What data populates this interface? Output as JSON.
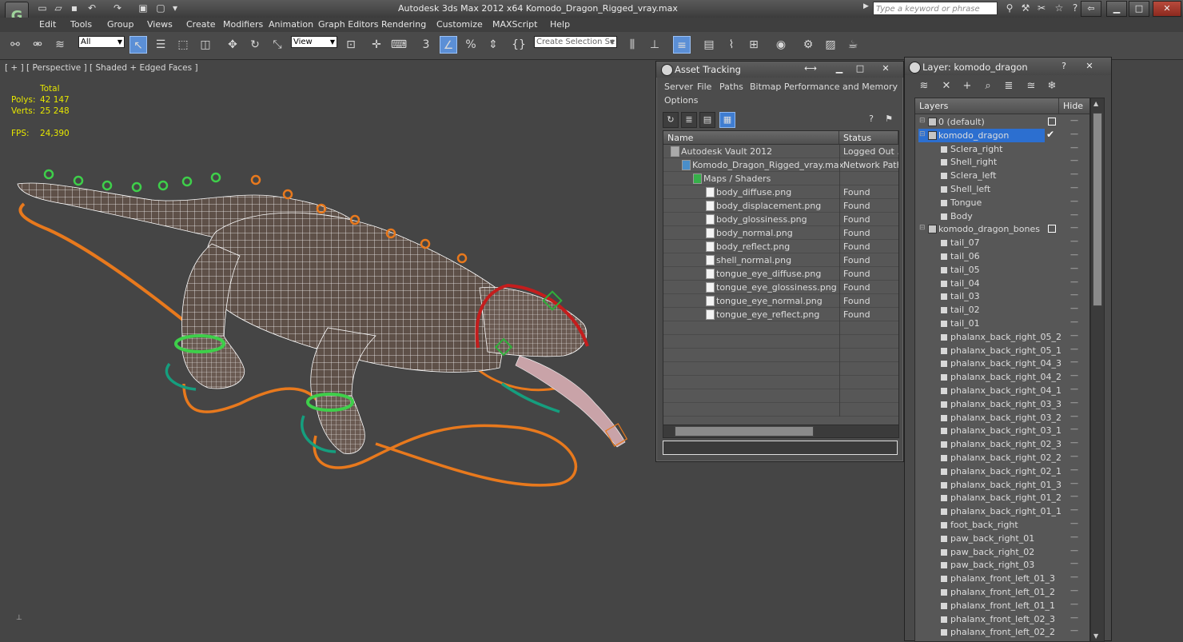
{
  "app": {
    "title": "Autodesk 3ds Max  2012 x64     Komodo_Dragon_Rigged_vray.max",
    "search_placeholder": "Type a keyword or phrase"
  },
  "menu": [
    "Edit",
    "Tools",
    "Group",
    "Views",
    "Create",
    "Modifiers",
    "Animation",
    "Graph Editors",
    "Rendering",
    "Customize",
    "MAXScript",
    "Help"
  ],
  "toolbar": {
    "filter_value": "All",
    "coord_value": "View",
    "selection_set_placeholder": "Create Selection Se"
  },
  "viewport": {
    "label": "[ + ] [ Perspective ] [ Shaded + Edged Faces ]",
    "stats": {
      "total_label": "Total",
      "polys_label": "Polys:",
      "polys_value": "42 147",
      "verts_label": "Verts:",
      "verts_value": "25 248",
      "fps_label": "FPS:",
      "fps_value": "24,390"
    }
  },
  "asset_tracking": {
    "title": "Asset Tracking",
    "menu": [
      "Server",
      "File",
      "Paths",
      "Bitmap Performance and Memory",
      "Options"
    ],
    "columns": [
      "Name",
      "Status"
    ],
    "rows": [
      {
        "name": "Autodesk Vault 2012",
        "status": "Logged Out ..."
      },
      {
        "name": "Komodo_Dragon_Rigged_vray.max",
        "status": "Network Path"
      },
      {
        "name": "Maps / Shaders",
        "status": ""
      },
      {
        "name": "body_diffuse.png",
        "status": "Found"
      },
      {
        "name": "body_displacement.png",
        "status": "Found"
      },
      {
        "name": "body_glossiness.png",
        "status": "Found"
      },
      {
        "name": "body_normal.png",
        "status": "Found"
      },
      {
        "name": "body_reflect.png",
        "status": "Found"
      },
      {
        "name": "shell_normal.png",
        "status": "Found"
      },
      {
        "name": "tongue_eye_diffuse.png",
        "status": "Found"
      },
      {
        "name": "tongue_eye_glossiness.png",
        "status": "Found"
      },
      {
        "name": "tongue_eye_normal.png",
        "status": "Found"
      },
      {
        "name": "tongue_eye_reflect.png",
        "status": "Found"
      }
    ]
  },
  "layer_panel": {
    "title": "Layer: komodo_dragon",
    "columns": [
      "Layers",
      "Hide"
    ],
    "rows": [
      {
        "name": "0 (default)",
        "level": 0,
        "type": "layer"
      },
      {
        "name": "komodo_dragon",
        "level": 0,
        "type": "layer",
        "selected": true
      },
      {
        "name": "Sclera_right",
        "level": 1,
        "type": "object"
      },
      {
        "name": "Shell_right",
        "level": 1,
        "type": "object"
      },
      {
        "name": "Sclera_left",
        "level": 1,
        "type": "object"
      },
      {
        "name": "Shell_left",
        "level": 1,
        "type": "object"
      },
      {
        "name": "Tongue",
        "level": 1,
        "type": "object"
      },
      {
        "name": "Body",
        "level": 1,
        "type": "object"
      },
      {
        "name": "komodo_dragon_bones",
        "level": 0,
        "type": "layer"
      },
      {
        "name": "tail_07",
        "level": 1,
        "type": "object"
      },
      {
        "name": "tail_06",
        "level": 1,
        "type": "object"
      },
      {
        "name": "tail_05",
        "level": 1,
        "type": "object"
      },
      {
        "name": "tail_04",
        "level": 1,
        "type": "object"
      },
      {
        "name": "tail_03",
        "level": 1,
        "type": "object"
      },
      {
        "name": "tail_02",
        "level": 1,
        "type": "object"
      },
      {
        "name": "tail_01",
        "level": 1,
        "type": "object"
      },
      {
        "name": "phalanx_back_right_05_2",
        "level": 1,
        "type": "object"
      },
      {
        "name": "phalanx_back_right_05_1",
        "level": 1,
        "type": "object"
      },
      {
        "name": "phalanx_back_right_04_3",
        "level": 1,
        "type": "object"
      },
      {
        "name": "phalanx_back_right_04_2",
        "level": 1,
        "type": "object"
      },
      {
        "name": "phalanx_back_right_04_1",
        "level": 1,
        "type": "object"
      },
      {
        "name": "phalanx_back_right_03_3",
        "level": 1,
        "type": "object"
      },
      {
        "name": "phalanx_back_right_03_2",
        "level": 1,
        "type": "object"
      },
      {
        "name": "phalanx_back_right_03_1",
        "level": 1,
        "type": "object"
      },
      {
        "name": "phalanx_back_right_02_3",
        "level": 1,
        "type": "object"
      },
      {
        "name": "phalanx_back_right_02_2",
        "level": 1,
        "type": "object"
      },
      {
        "name": "phalanx_back_right_02_1",
        "level": 1,
        "type": "object"
      },
      {
        "name": "phalanx_back_right_01_3",
        "level": 1,
        "type": "object"
      },
      {
        "name": "phalanx_back_right_01_2",
        "level": 1,
        "type": "object"
      },
      {
        "name": "phalanx_back_right_01_1",
        "level": 1,
        "type": "object"
      },
      {
        "name": "foot_back_right",
        "level": 1,
        "type": "object"
      },
      {
        "name": "paw_back_right_01",
        "level": 1,
        "type": "object"
      },
      {
        "name": "paw_back_right_02",
        "level": 1,
        "type": "object"
      },
      {
        "name": "paw_back_right_03",
        "level": 1,
        "type": "object"
      },
      {
        "name": "phalanx_front_left_01_3",
        "level": 1,
        "type": "object"
      },
      {
        "name": "phalanx_front_left_01_2",
        "level": 1,
        "type": "object"
      },
      {
        "name": "phalanx_front_left_01_1",
        "level": 1,
        "type": "object"
      },
      {
        "name": "phalanx_front_left_02_3",
        "level": 1,
        "type": "object"
      },
      {
        "name": "phalanx_front_left_02_2",
        "level": 1,
        "type": "object"
      }
    ]
  },
  "colors": {
    "selection": "#2c6fd0",
    "stats_text": "#e6e600",
    "ik_orange": "#e8791d",
    "control_green": "#3ecf4a",
    "neck_red": "#c41d1d",
    "teal": "#159e7e"
  }
}
